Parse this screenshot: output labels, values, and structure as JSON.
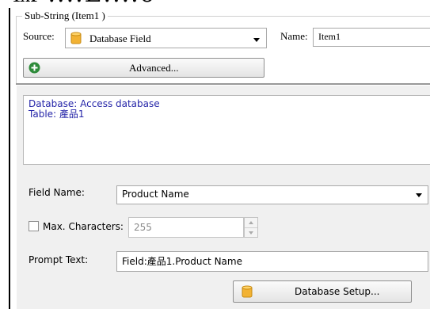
{
  "top_fragment": "Ѩ ....Ѐ....ӫ",
  "group": {
    "title": "Sub-String (Item1 )",
    "source_label": "Source:",
    "source_value": "Database Field",
    "name_label": "Name:",
    "name_value": "Item1",
    "advanced_label": "Advanced..."
  },
  "memo": {
    "line1": "Database: Access database",
    "line2": "Table: 產品1"
  },
  "field_name": {
    "label": "Field Name:",
    "value": "Product Name"
  },
  "max_chars": {
    "label": "Max. Characters:",
    "value": "255",
    "checked": false
  },
  "prompt": {
    "label": "Prompt Text:",
    "value": "Field:產品1.Product Name"
  },
  "db_setup_label": "Database Setup...",
  "colors": {
    "memo_text": "#2424a8",
    "panel_bg": "#f0f0f0",
    "database_icon": "#f2b233",
    "plus_icon": "#2e8b3a"
  }
}
